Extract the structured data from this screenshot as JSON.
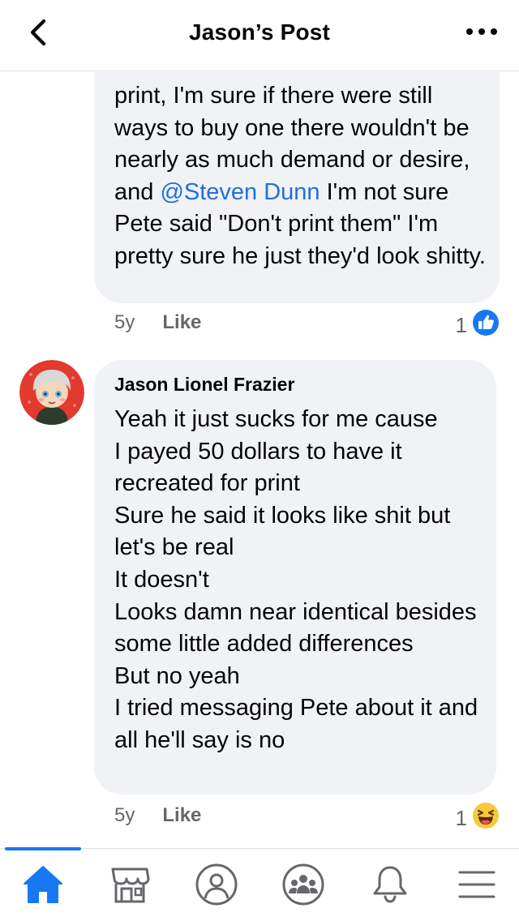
{
  "header": {
    "title": "Jason’s Post",
    "back_icon": "back-chevron-icon",
    "more_icon": "more-dots-icon"
  },
  "comments": [
    {
      "author": "",
      "text_before": "print, I'm sure if there were still ways to buy one there wouldn't be nearly as much demand or desire, and ",
      "mention": "@Steven Dunn",
      "text_after": " I'm not sure Pete said \"Don't print them\" I'm pretty sure he just they'd look shitty.",
      "time": "5y",
      "like_label": "Like",
      "reaction_count": "1",
      "reaction_icon": "like-reaction-icon"
    },
    {
      "author": "Jason Lionel Frazier",
      "text": "Yeah it just sucks for me cause\nI payed 50 dollars to have it recreated for print\nSure he said it looks like shit but let's be real\nIt doesn't\nLooks damn near identical besides some little added differences\nBut no yeah\nI tried messaging Pete about it and all he'll say is no",
      "time": "5y",
      "like_label": "Like",
      "reaction_count": "1",
      "reaction_icon": "haha-reaction-icon",
      "avatar_icon": "avatar"
    }
  ],
  "tabbar": {
    "active": "home",
    "items": [
      {
        "name": "home",
        "icon": "home-icon"
      },
      {
        "name": "marketplace",
        "icon": "marketplace-icon"
      },
      {
        "name": "profile",
        "icon": "profile-icon"
      },
      {
        "name": "groups",
        "icon": "groups-icon"
      },
      {
        "name": "notifications",
        "icon": "bell-icon"
      },
      {
        "name": "menu",
        "icon": "menu-icon"
      }
    ]
  },
  "colors": {
    "accent": "#1877f2",
    "mention": "#216fdb",
    "bubble": "#f0f2f5",
    "meta": "#65676b"
  }
}
